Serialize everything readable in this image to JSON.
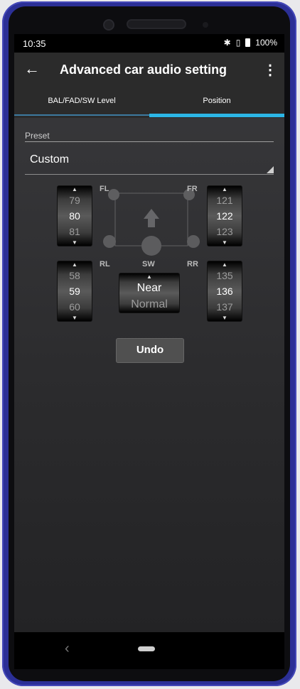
{
  "status": {
    "time": "10:35",
    "bluetooth_icon": "bluetooth-icon",
    "vibrate_icon": "vibrate-icon",
    "battery": "100%"
  },
  "appbar": {
    "title": "Advanced car audio setting",
    "back_icon": "back-arrow-icon",
    "menu_icon": "more-vert-icon"
  },
  "tabs": [
    {
      "label": "BAL/FAD/SW Level"
    },
    {
      "label": "Position"
    }
  ],
  "active_tab": "Position",
  "preset": {
    "label": "Preset",
    "value": "Custom"
  },
  "speakers": {
    "fl": {
      "label": "FL",
      "prev": "79",
      "current": "80",
      "next": "81"
    },
    "fr": {
      "label": "FR",
      "prev": "121",
      "current": "122",
      "next": "123"
    },
    "rl": {
      "label": "RL",
      "prev": "58",
      "current": "59",
      "next": "60"
    },
    "rr": {
      "label": "RR",
      "prev": "135",
      "current": "136",
      "next": "137"
    },
    "sw": {
      "label": "SW",
      "current": "Near",
      "next": "Normal"
    }
  },
  "undo_label": "Undo",
  "colors": {
    "accent": "#2cb6e6",
    "background": "#2b2b2d",
    "frame": "#2b2f96"
  }
}
